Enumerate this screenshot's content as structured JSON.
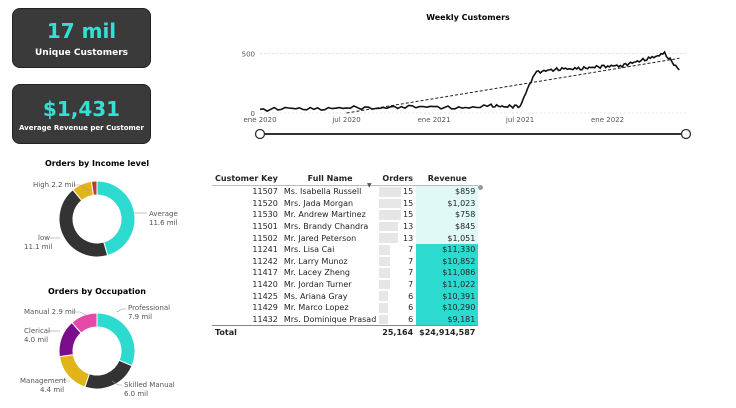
{
  "kpi_customers": {
    "value": "17 mil",
    "label": "Unique Customers"
  },
  "kpi_revenue": {
    "value": "$1,431",
    "label": "Average Revenue per Customer"
  },
  "colors": {
    "kpi_background": "#3a3a3a",
    "kpi_value": "#32e0d4",
    "teal": "#2ddad0",
    "dark": "#333333",
    "gold": "#e1b418",
    "crimson": "#c0392b",
    "purple": "#7a0d8b",
    "magenta": "#e54aa9",
    "revenue_light": "#e0f9f7"
  },
  "chart_data": [
    {
      "type": "line",
      "title": "Weekly Customers",
      "x_ticks": [
        "ene 2020",
        "jul 2020",
        "ene 2021",
        "jul 2021",
        "ene 2022"
      ],
      "y_ticks": [
        0,
        500
      ],
      "ylim": [
        0,
        580
      ],
      "x": [
        "2020-01",
        "2020-03",
        "2020-05",
        "2020-07",
        "2020-09",
        "2020-11",
        "2021-01",
        "2021-03",
        "2021-05",
        "2021-06",
        "2021-07",
        "2021-08",
        "2021-09",
        "2021-10",
        "2021-11",
        "2021-12",
        "2022-01",
        "2022-02",
        "2022-03",
        "2022-04",
        "2022-05",
        "2022-06"
      ],
      "series": [
        {
          "values": [
            25,
            40,
            30,
            48,
            40,
            55,
            50,
            40,
            60,
            55,
            58,
            340,
            360,
            370,
            370,
            385,
            395,
            400,
            430,
            460,
            500,
            360
          ]
        }
      ],
      "trend_line": {
        "start": [
          "2020-07",
          0
        ],
        "end": [
          "2022-06",
          460
        ]
      },
      "grid": "horizontal",
      "legend": "none",
      "slider": true
    },
    {
      "type": "pie",
      "donut": true,
      "title": "Orders by Income level",
      "series": [
        {
          "name": "Average",
          "value": 11.6,
          "value_label": "11.6 mil"
        },
        {
          "name": "low",
          "value": 11.1,
          "value_label": "11.1 mil"
        },
        {
          "name": "High",
          "value": 2.2,
          "value_label": "2.2 mil"
        },
        {
          "name": "",
          "value": 0.6
        }
      ],
      "legend": "none"
    },
    {
      "type": "pie",
      "donut": true,
      "title": "Orders by Occupation",
      "series": [
        {
          "name": "Professional",
          "value": 7.9,
          "value_label": "7.9 mil"
        },
        {
          "name": "Skilled Manual",
          "value": 6.0,
          "value_label": "6.0 mil"
        },
        {
          "name": "Management",
          "value": 4.4,
          "value_label": "4.4 mil"
        },
        {
          "name": "Clerical",
          "value": 4.0,
          "value_label": "4.0 mil"
        },
        {
          "name": "Manual",
          "value": 2.9,
          "value_label": "2.9 mil"
        }
      ],
      "legend": "none"
    },
    {
      "type": "table",
      "columns": [
        "Customer Key",
        "Full Name",
        "Orders",
        "Revenue"
      ],
      "sort": {
        "column": "Orders",
        "direction": "descending"
      },
      "rows": [
        {
          "key": "11507",
          "name": "Ms. Isabella Russell",
          "orders": 15,
          "revenue": "$859",
          "revenue_value": 859
        },
        {
          "key": "11520",
          "name": "Mrs. Jada Morgan",
          "orders": 15,
          "revenue": "$1,023",
          "revenue_value": 1023
        },
        {
          "key": "11530",
          "name": "Mr. Andrew Martinez",
          "orders": 15,
          "revenue": "$758",
          "revenue_value": 758
        },
        {
          "key": "11501",
          "name": "Mrs. Brandy Chandra",
          "orders": 13,
          "revenue": "$845",
          "revenue_value": 845
        },
        {
          "key": "11502",
          "name": "Mr. Jared Peterson",
          "orders": 13,
          "revenue": "$1,051",
          "revenue_value": 1051
        },
        {
          "key": "11241",
          "name": "Mrs. Lisa Cai",
          "orders": 7,
          "revenue": "$11,330",
          "revenue_value": 11330
        },
        {
          "key": "11242",
          "name": "Mr. Larry Munoz",
          "orders": 7,
          "revenue": "$10,852",
          "revenue_value": 10852
        },
        {
          "key": "11417",
          "name": "Mr. Lacey Zheng",
          "orders": 7,
          "revenue": "$11,086",
          "revenue_value": 11086
        },
        {
          "key": "11420",
          "name": "Mr. Jordan Turner",
          "orders": 7,
          "revenue": "$11,022",
          "revenue_value": 11022
        },
        {
          "key": "11425",
          "name": "Ms. Ariana Gray",
          "orders": 6,
          "revenue": "$10,391",
          "revenue_value": 10391
        },
        {
          "key": "11429",
          "name": "Mr. Marco Lopez",
          "orders": 6,
          "revenue": "$10,290",
          "revenue_value": 10290
        },
        {
          "key": "11432",
          "name": "Mrs. Dominique Prasad",
          "orders": 6,
          "revenue": "$9,181",
          "revenue_value": 9181
        }
      ],
      "total": {
        "label": "Total",
        "orders": "25,164",
        "revenue": "$24,914,587"
      }
    }
  ]
}
